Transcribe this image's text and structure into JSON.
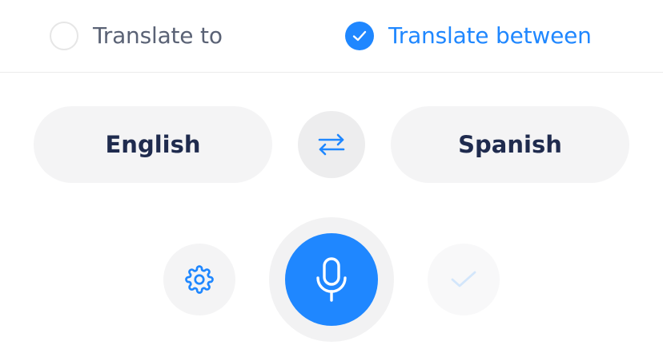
{
  "mode_selector": {
    "options": [
      {
        "label": "Translate to",
        "selected": false
      },
      {
        "label": "Translate between",
        "selected": true
      }
    ]
  },
  "languages": {
    "source": "English",
    "target": "Spanish",
    "swap_icon": "swap-arrows-icon"
  },
  "controls": {
    "settings_icon": "gear-icon",
    "microphone_icon": "microphone-icon",
    "confirm_icon": "checkmark-icon",
    "confirm_enabled": false
  },
  "colors": {
    "accent": "#1f87ff",
    "text_dark": "#1f2b4e",
    "text_muted": "#5a6275",
    "pill_background": "#f4f4f5"
  }
}
